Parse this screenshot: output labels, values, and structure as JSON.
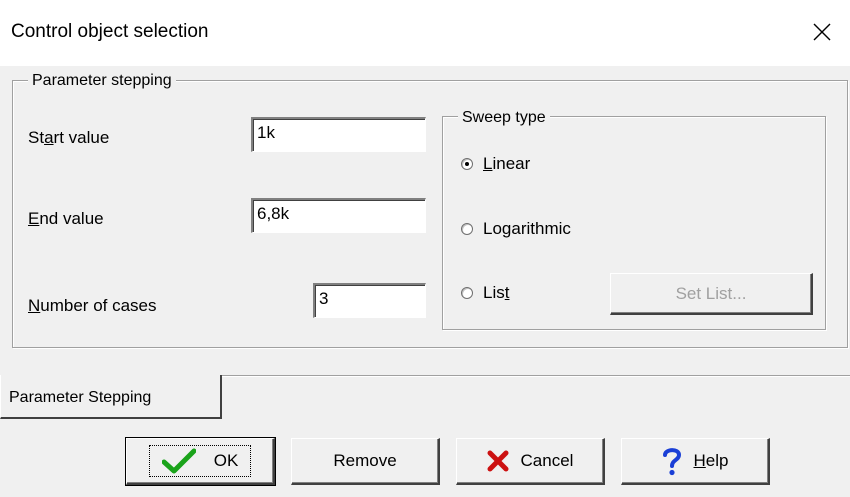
{
  "window": {
    "title": "Control object selection",
    "close_icon": "close-icon"
  },
  "parameter_group": {
    "title": "Parameter stepping",
    "start": {
      "label_pre": "St",
      "label_u": "a",
      "label_post": "rt value",
      "value": "1k"
    },
    "end": {
      "label_u": "E",
      "label_post": "nd value",
      "value": "6,8k"
    },
    "cases": {
      "label_u": "N",
      "label_post": "umber of cases",
      "value": "3"
    }
  },
  "sweep_group": {
    "title": "Sweep type",
    "linear": {
      "label_u": "L",
      "label_post": "inear",
      "checked": true
    },
    "log": {
      "label_pre": "Lo",
      "label_u": "g",
      "label_post": "arithmic",
      "checked": false
    },
    "list": {
      "label_pre": "Lis",
      "label_u": "t",
      "checked": false
    },
    "set_list_button": "Set List..."
  },
  "tabs": [
    {
      "label": "Parameter Stepping",
      "active": true
    }
  ],
  "buttons": {
    "ok": "OK",
    "remove": "Remove",
    "cancel": "Cancel",
    "help_u": "H",
    "help_post": "elp"
  },
  "colors": {
    "ok_check": "#1aa31a",
    "cancel_x": "#cc1111",
    "help_q": "#1a3fd6"
  }
}
